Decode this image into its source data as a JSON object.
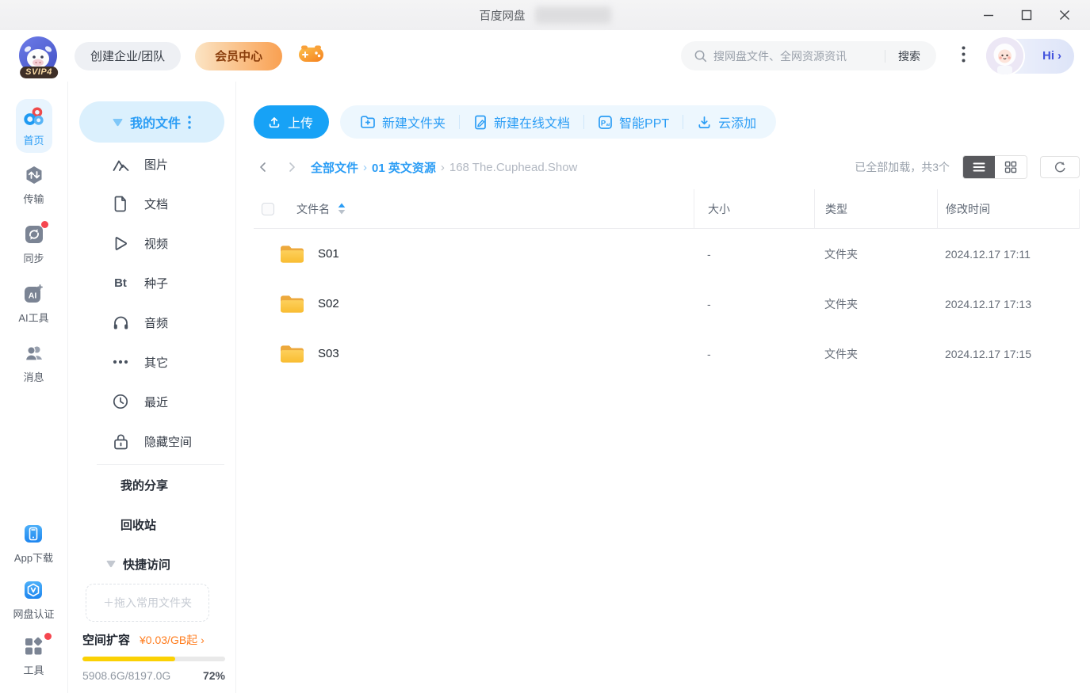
{
  "colors": {
    "accent_blue": "#2b9df5",
    "active_item_bg": "#e8f4fe",
    "vip_gradient": [
      "#fbe4c4",
      "#f9a051"
    ],
    "vip_text": "#8a3e0c",
    "price_orange": "#ff7d1f",
    "progress_yellow": "#fbd104",
    "badge_red": "#f5464f",
    "folder_yellow": "#fbc535"
  },
  "icons": {
    "chevron_right": "›",
    "plus": "＋"
  },
  "titlebar": {
    "title": "百度网盘"
  },
  "header": {
    "vip_badge": "SVIP4",
    "create_team": "创建企业/团队",
    "member_center": "会员中心",
    "search": {
      "placeholder": "搜网盘文件、全网资源资讯",
      "button": "搜索"
    },
    "greeting": "Hi"
  },
  "rail": {
    "items": [
      "首页",
      "传输",
      "同步",
      "AI工具",
      "消息"
    ],
    "bottom": [
      "App下载",
      "网盘认证",
      "工具"
    ]
  },
  "nav": {
    "my_files": "我的文件",
    "categories": [
      "图片",
      "文档",
      "视频",
      "种子",
      "音频",
      "其它",
      "最近",
      "隐藏空间"
    ],
    "bt_glyph": "Bt",
    "my_share": "我的分享",
    "recycle_bin": "回收站",
    "quick_access": "快捷访问",
    "drop_zone": "＋拖入常用文件夹",
    "storage": {
      "label": "空间扩容",
      "price": "¥0.03/GB起",
      "used": "5908.6G/8197.0G",
      "percent_label": "72%",
      "bar_percent": 65
    }
  },
  "toolbar": {
    "upload": "上传",
    "new_folder": "新建文件夹",
    "new_online_doc": "新建在线文档",
    "smart_ppt": "智能PPT",
    "cloud_add": "云添加"
  },
  "breadcrumb": {
    "items": [
      "全部文件",
      "01 英文资源",
      "168 The.Cuphead.Show"
    ]
  },
  "listbar": {
    "load_status": "已全部加载，共3个"
  },
  "table": {
    "columns": [
      "文件名",
      "大小",
      "类型",
      "修改时间"
    ],
    "rows": [
      {
        "name": "S01",
        "size": "-",
        "type": "文件夹",
        "modified": "2024.12.17 17:11"
      },
      {
        "name": "S02",
        "size": "-",
        "type": "文件夹",
        "modified": "2024.12.17 17:13"
      },
      {
        "name": "S03",
        "size": "-",
        "type": "文件夹",
        "modified": "2024.12.17 17:15"
      }
    ]
  }
}
